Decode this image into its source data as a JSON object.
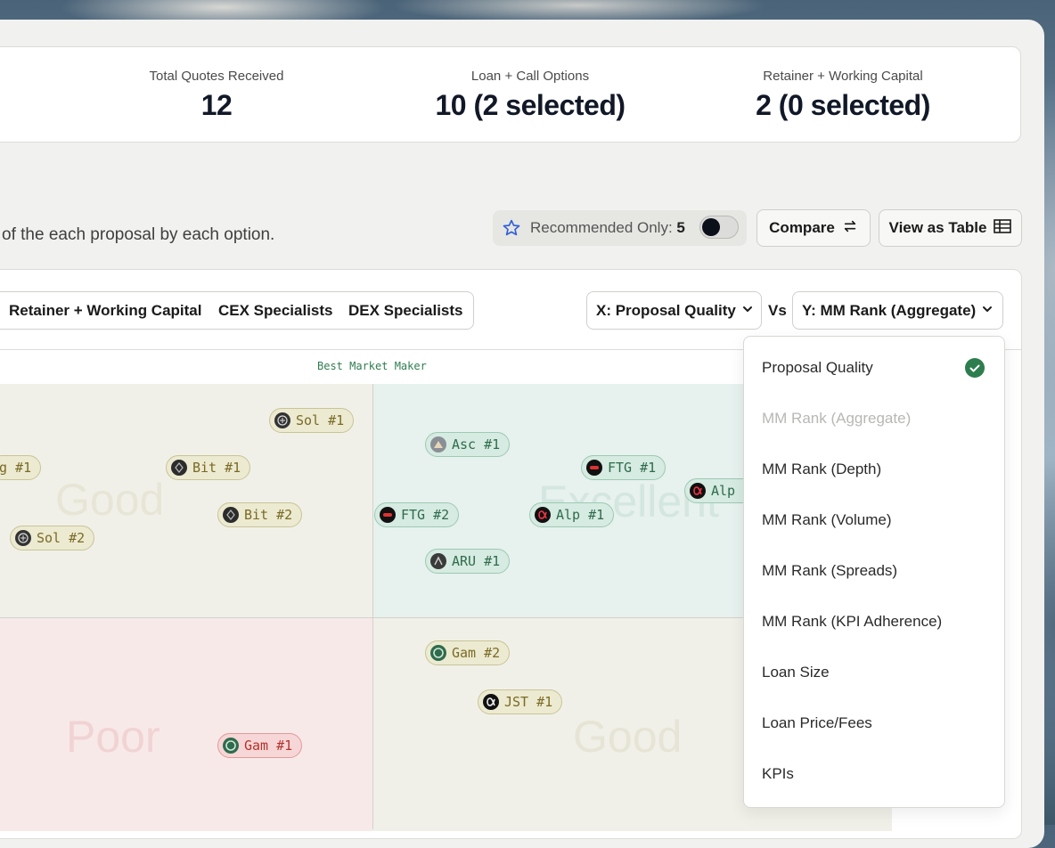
{
  "stats": [
    {
      "label": "Total Quotes Received",
      "value": "12"
    },
    {
      "label": "Loan + Call Options",
      "value": "10 (2 selected)"
    },
    {
      "label": "Retainer + Working Capital",
      "value": "2 (0 selected)"
    }
  ],
  "subtitle": "of the each proposal by each option.",
  "recommended": {
    "label": "Recommended Only:",
    "count": "5",
    "toggle_on": false
  },
  "buttons": {
    "compare": "Compare",
    "view_table": "View as Table"
  },
  "tabs": [
    "Retainer + Working Capital",
    "CEX Specialists",
    "DEX Specialists"
  ],
  "axis": {
    "x_select": "X: Proposal Quality",
    "vs": "Vs",
    "y_select": "Y: MM Rank (Aggregate)"
  },
  "chart": {
    "top_label": "Best Market Maker",
    "quadrants": {
      "top_left": "Good",
      "top_right": "Excellent",
      "bottom_left": "Poor",
      "bottom_right": "Good"
    },
    "pills": [
      {
        "label": "Sol #1",
        "quadrant": "good",
        "logo": "solana-logo"
      },
      {
        "label": "g #1",
        "quadrant": "good",
        "logo": "none"
      },
      {
        "label": "Bit #1",
        "quadrant": "good",
        "logo": "bitget-logo"
      },
      {
        "label": "Bit #2",
        "quadrant": "good",
        "logo": "bitget-logo"
      },
      {
        "label": "Sol #2",
        "quadrant": "good",
        "logo": "solana-logo"
      },
      {
        "label": "Asc #1",
        "quadrant": "excellent",
        "logo": "ascent-logo"
      },
      {
        "label": "FTG #1",
        "quadrant": "excellent",
        "logo": "ftg-logo"
      },
      {
        "label": "Alp",
        "quadrant": "excellent",
        "logo": "alpha-logo"
      },
      {
        "label": "FTG #2",
        "quadrant": "excellent",
        "logo": "ftg-logo"
      },
      {
        "label": "Alp #1",
        "quadrant": "excellent",
        "logo": "alpha-logo"
      },
      {
        "label": "ARU #1",
        "quadrant": "excellent",
        "logo": "aru-logo"
      },
      {
        "label": "Gam #2",
        "quadrant": "good",
        "logo": "gamma-logo"
      },
      {
        "label": "JST #1",
        "quadrant": "good",
        "logo": "alpha-logo"
      },
      {
        "label": "Gam #1",
        "quadrant": "poor",
        "logo": "gamma-logo"
      }
    ]
  },
  "dropdown": {
    "items": [
      {
        "label": "Proposal Quality",
        "state": "selected"
      },
      {
        "label": "MM Rank (Aggregate)",
        "state": "disabled"
      },
      {
        "label": "MM Rank (Depth)",
        "state": "normal"
      },
      {
        "label": "MM Rank (Volume)",
        "state": "normal"
      },
      {
        "label": "MM Rank (Spreads)",
        "state": "normal"
      },
      {
        "label": "MM Rank (KPI Adherence)",
        "state": "normal"
      },
      {
        "label": "Loan Size",
        "state": "normal"
      },
      {
        "label": "Loan Price/Fees",
        "state": "normal"
      },
      {
        "label": "KPIs",
        "state": "normal"
      }
    ]
  },
  "colors": {
    "accent_green": "#2e7d4f",
    "text_dark": "#111827",
    "poor_red": "#b4332f"
  }
}
